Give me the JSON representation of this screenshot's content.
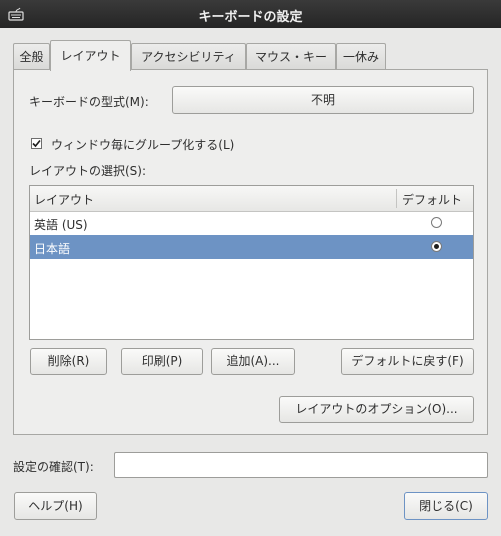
{
  "window": {
    "title": "キーボードの設定"
  },
  "tabs": [
    {
      "label": "全般"
    },
    {
      "label": "レイアウト"
    },
    {
      "label": "アクセシビリティ"
    },
    {
      "label": "マウス・キー"
    },
    {
      "label": "一休み"
    }
  ],
  "active_tab": "レイアウト",
  "layout": {
    "model_label": "キーボードの型式(M):",
    "model_value": "不明",
    "per_window_label": "ウィンドウ毎にグループ化する(L)",
    "per_window_checked": true,
    "select_label": "レイアウトの選択(S):",
    "columns": {
      "layout": "レイアウト",
      "default": "デフォルト"
    },
    "rows": [
      {
        "name": "英語 (US)",
        "default": false,
        "selected": false
      },
      {
        "name": "日本語",
        "default": true,
        "selected": true
      }
    ],
    "buttons": {
      "remove": "削除(R)",
      "print": "印刷(P)",
      "add": "追加(A)...",
      "reset_default": "デフォルトに戻す(F)",
      "options": "レイアウトのオプション(O)..."
    }
  },
  "confirm": {
    "label": "設定の確認(T):",
    "value": ""
  },
  "footer": {
    "help": "ヘルプ(H)",
    "close": "閉じる(C)"
  }
}
